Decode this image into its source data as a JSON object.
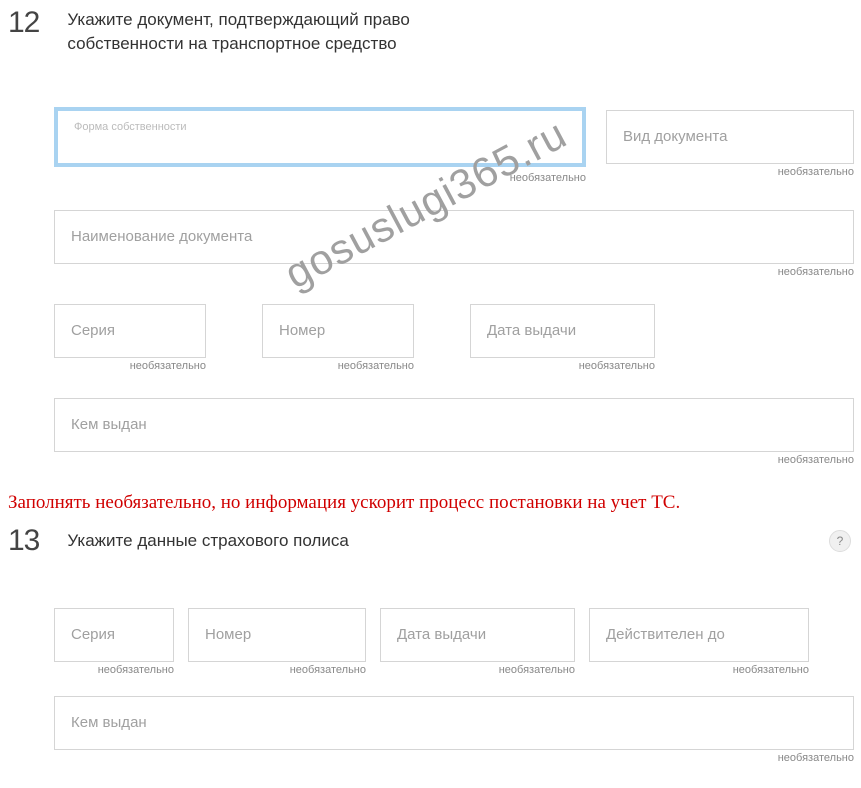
{
  "watermark": "gosuslugi365.ru",
  "optional_label": "необязательно",
  "note": "Заполнять необязательно, но информация ускорит процесс постановки на учет ТС.",
  "help_icon": "?",
  "section12": {
    "number": "12",
    "title": "Укажите документ, подтверждающий право собственности на транспортное средство",
    "fields": {
      "ownership_form": "Форма собственности",
      "doc_type": "Вид документа",
      "doc_name": "Наименование документа",
      "series": "Серия",
      "number": "Номер",
      "issue_date": "Дата выдачи",
      "issued_by": "Кем выдан"
    }
  },
  "section13": {
    "number": "13",
    "title": "Укажите данные страхового полиса",
    "fields": {
      "series": "Серия",
      "number": "Номер",
      "issue_date": "Дата выдачи",
      "valid_until": "Действителен до",
      "issued_by": "Кем выдан"
    }
  }
}
